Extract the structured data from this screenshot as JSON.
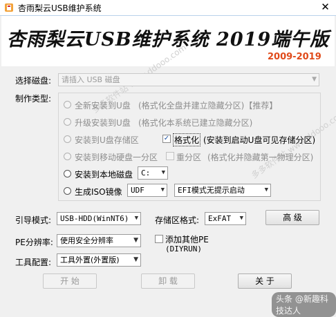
{
  "window": {
    "title": "杏雨梨云USB维护系统",
    "close_glyph": "✕"
  },
  "banner": {
    "title": "杏雨梨云USB维护系统 2019端午版",
    "year_range": "2009-2019",
    "year_color": "#e04a1a"
  },
  "disk_select": {
    "label": "选择磁盘:",
    "value": "请插入 USB 磁盘",
    "disabled": true
  },
  "make_type": {
    "label": "制作类型:",
    "options": [
      {
        "label": "全新安装到U盘",
        "desc": "(格式化全盘并建立隐藏分区)【推荐】",
        "enabled": false
      },
      {
        "label": "升级安装到U盘",
        "desc": "(格式化本系统已建立隐藏分区)",
        "enabled": false
      },
      {
        "label": "安装到U盘存储区",
        "check_label": "格式化",
        "check_checked": true,
        "desc": "(安装到启动U盘可见存储分区)",
        "enabled": false
      },
      {
        "label": "安装到移动硬盘一分区",
        "check_label": "重分区",
        "check_checked": false,
        "desc": "(格式化并隐藏第一物理分区)",
        "enabled": false
      },
      {
        "label": "安装到本地磁盘",
        "combo_value": "C:",
        "enabled": true
      },
      {
        "label": "生成ISO镜像",
        "combo_value": "UDF",
        "combo2_value": "EFI模式无提示启动",
        "enabled": true
      }
    ]
  },
  "boot_mode": {
    "label": "引导模式:",
    "value": "USB-HDD(WinNT6)"
  },
  "storage_format": {
    "label": "存储区格式:",
    "value": "ExFAT"
  },
  "advanced_button": "高 级",
  "pe_resolution": {
    "label": "PE分辨率:",
    "value": "使用安全分辨率"
  },
  "add_other_pe": {
    "label": "添加其他PE",
    "sub": "(DIYRUN)",
    "checked": false
  },
  "tool_config": {
    "label": "工具配置:",
    "value": "工具外置(外置版)"
  },
  "buttons": {
    "start": "开 始",
    "uninstall": "卸 载",
    "about": "关 于"
  },
  "watermark_text": "多多软件站 www.ddooo.com",
  "wechat_tag": "头条 @新趣科技达人"
}
